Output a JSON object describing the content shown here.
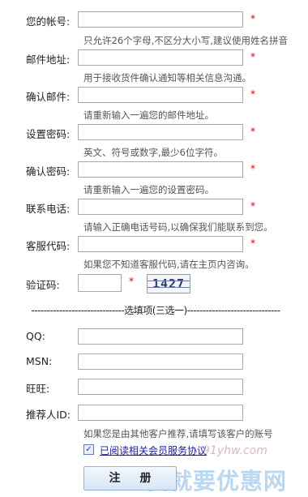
{
  "form": {
    "account": {
      "label": "您的帐号:",
      "hint": "只允许26个字母,不区分大小写,建议使用姓名拼音"
    },
    "email": {
      "label": "邮件地址:",
      "hint": "用于接收货件确认通知等相关信息沟通。"
    },
    "email_confirm": {
      "label": "确认邮件:",
      "hint": "请重新输入一遍您的邮件地址。"
    },
    "password": {
      "label": "设置密码:",
      "hint": "英文、符号或数字,最少6位字符。"
    },
    "password_confirm": {
      "label": "确认密码:",
      "hint": "请重新输入一遍您的设置密码。"
    },
    "phone": {
      "label": "联系电话:",
      "hint": "请输入正确电话号码,以确保我们能联系到您。"
    },
    "service_code": {
      "label": "客服代码:",
      "hint": "如果您不知道客服代码,请在主页内咨询。"
    },
    "captcha": {
      "label": "验证码:",
      "code": "1427"
    },
    "required_mark": "*"
  },
  "optional": {
    "divider": "------------------------------选填项(三选一)------------------------------",
    "qq": {
      "label": "QQ:"
    },
    "msn": {
      "label": "MSN:"
    },
    "wangwang": {
      "label": "旺旺:"
    },
    "referrer": {
      "label": "推荐人ID:",
      "hint": "如果您是由其他客户推荐,请填写该客户的账号"
    }
  },
  "agreement": {
    "checked": true,
    "label": "已阅读相关会员服务协议"
  },
  "submit_label": "注册",
  "watermark": {
    "url": "91yhw.com",
    "text": "我就要优惠网"
  }
}
